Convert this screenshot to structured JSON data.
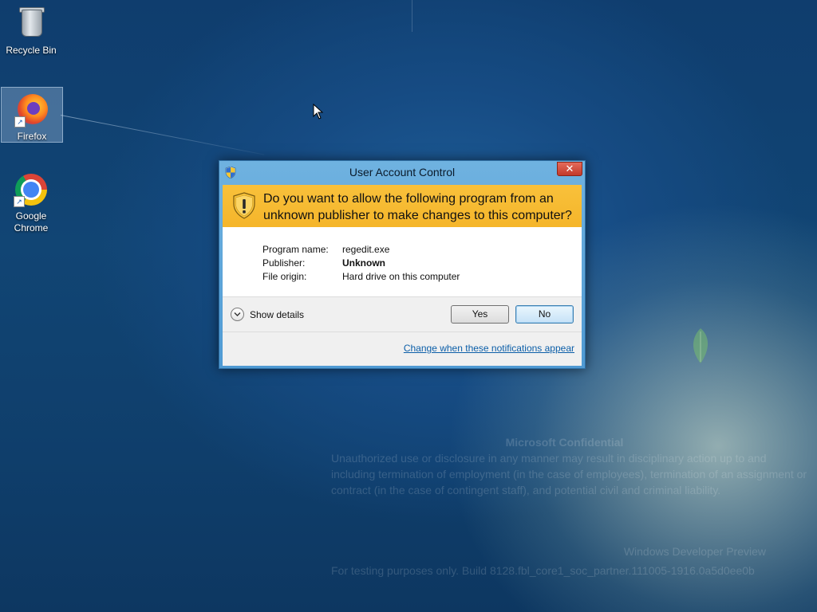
{
  "desktop": {
    "icons": [
      {
        "label": "Recycle Bin",
        "icon": "recycle-bin-icon"
      },
      {
        "label": "Firefox",
        "icon": "firefox-icon"
      },
      {
        "label": "Google Chrome",
        "icon": "chrome-icon"
      }
    ]
  },
  "dialog": {
    "title": "User Account Control",
    "close_glyph": "✕",
    "question": "Do you want to allow the following program from an unknown publisher to make changes to this computer?",
    "program_label": "Program name:",
    "program_value": "regedit.exe",
    "publisher_label": "Publisher:",
    "publisher_value": "Unknown",
    "origin_label": "File origin:",
    "origin_value": "Hard drive on this computer",
    "show_details": "Show details",
    "yes": "Yes",
    "no": "No",
    "change_link": "Change when these notifications appear",
    "banner_color": "#f6b92f",
    "accent_color": "#4f9ad3"
  },
  "watermark": {
    "title": "Microsoft Confidential",
    "body": "Unauthorized use or disclosure in any manner may result in disciplinary action up to and including termination of employment (in the case of employees), termination of an assignment or contract (in the case of contingent staff), and potential civil and criminal liability.",
    "build_title": "Windows Developer Preview",
    "build": "For testing purposes only. Build 8128.fbl_core1_soc_partner.111005-1916.0a5d0ee0b"
  }
}
